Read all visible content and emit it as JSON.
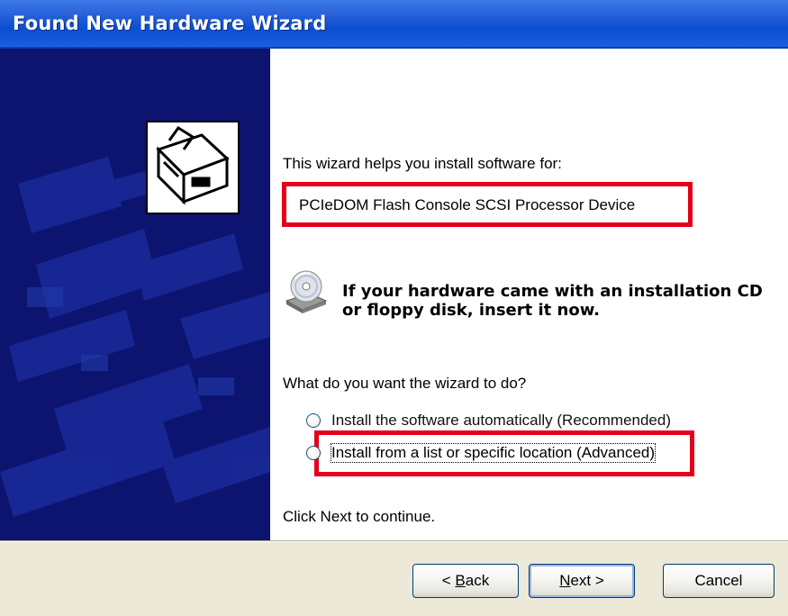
{
  "window": {
    "title": "Found New Hardware Wizard"
  },
  "content": {
    "intro": "This wizard helps you install software for:",
    "device_name": "PCIeDOM Flash Console SCSI Processor Device",
    "cd_prompt_line1": "If your hardware came with an installation CD",
    "cd_prompt_line2": "or floppy disk, insert it now.",
    "question": "What do you want the wizard to do?",
    "options": [
      {
        "label": "Install the software automatically (Recommended)",
        "selected": false
      },
      {
        "label": "Install from a list or specific location (Advanced)",
        "selected": false
      }
    ],
    "continue_text": "Click Next to continue."
  },
  "buttons": {
    "back_prefix": "< ",
    "back_mnemonic": "B",
    "back_rest": "ack",
    "next_mnemonic": "N",
    "next_rest": "ext >",
    "cancel": "Cancel"
  },
  "colors": {
    "highlight": "#e3001b",
    "title_bar": "#0a4fd0",
    "side_panel": "#0c1470"
  },
  "icons": {
    "hardware": "hardware-card-icon",
    "cd": "cd-drive-icon"
  }
}
